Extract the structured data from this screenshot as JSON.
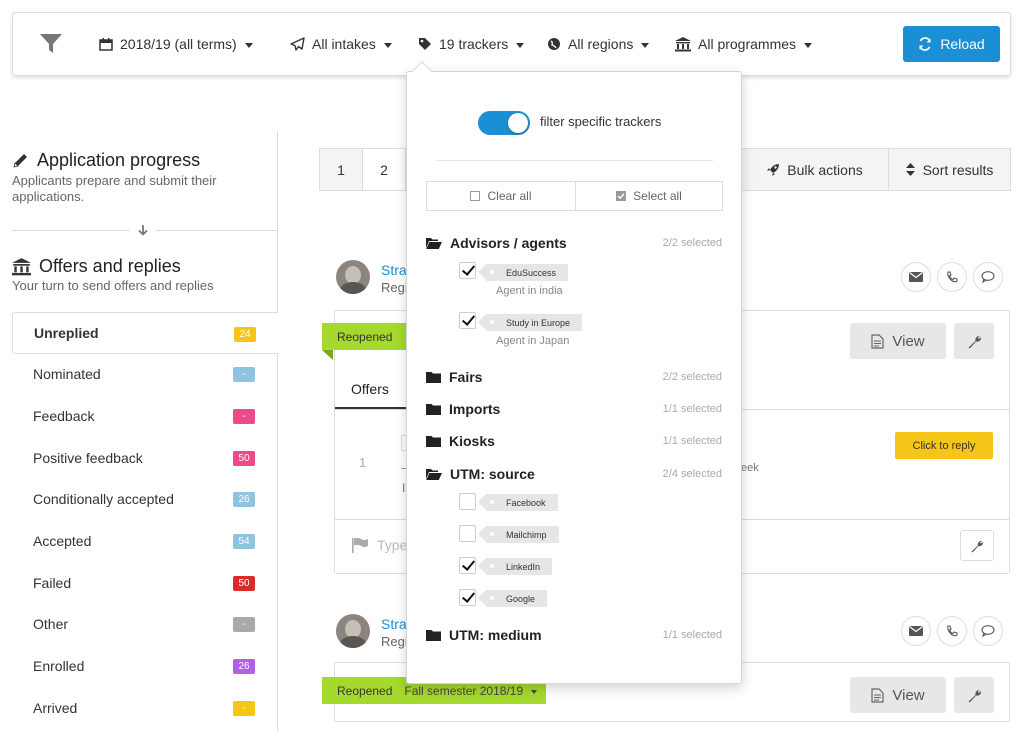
{
  "filterbar": {
    "year": "2018/19 (all terms)",
    "intakes": "All intakes",
    "trackers": "19 trackers",
    "regions": "All regions",
    "programmes": "All programmes",
    "reload": "Reload"
  },
  "left": {
    "progress_title": "Application progress",
    "progress_sub": "Applicants prepare and submit their applications.",
    "offers_title": "Offers and replies",
    "offers_sub": "Your turn to send offers and replies",
    "statuses": [
      {
        "label": "Unreplied",
        "count": "24",
        "color": "#f5c518"
      },
      {
        "label": "Nominated",
        "count": "-",
        "color": "#8fc3df"
      },
      {
        "label": "Feedback",
        "count": "-",
        "color": "#ee4a8a"
      },
      {
        "label": "Positive feedback",
        "count": "50",
        "color": "#ee4a8a"
      },
      {
        "label": "Conditionally accepted",
        "count": "26",
        "color": "#8fc3df"
      },
      {
        "label": "Accepted",
        "count": "54",
        "color": "#8fc3df"
      },
      {
        "label": "Failed",
        "count": "50",
        "color": "#d92b2b"
      },
      {
        "label": "Other",
        "count": "-",
        "color": "#aaaaaa"
      },
      {
        "label": "Enrolled",
        "count": "26",
        "color": "#b45ee8"
      },
      {
        "label": "Arrived",
        "count": "-",
        "color": "#f5c518"
      }
    ]
  },
  "main": {
    "page1": "1",
    "page2": "2",
    "bulk_actions": "Bulk actions",
    "sort_results": "Sort results",
    "card1": {
      "name": "Stra",
      "sub": "Regi",
      "tag": "Reopened",
      "view": "View",
      "tab": "Offers",
      "row_num": "1",
      "row_i": "I",
      "week": "eek",
      "click_reply": "Click to reply",
      "type_placeholder": "Type"
    },
    "card2": {
      "name": "Stra",
      "sub": "Regi",
      "tag": "Reopened",
      "semester": "Fall semester 2018/19",
      "view": "View"
    }
  },
  "dropdown": {
    "toggle_label": "filter specific trackers",
    "clear_all": "Clear all",
    "select_all": "Select all",
    "groups": {
      "advisors": {
        "name": "Advisors / agents",
        "count": "2/2 selected"
      },
      "fairs": {
        "name": "Fairs",
        "count": "2/2 selected"
      },
      "imports": {
        "name": "Imports",
        "count": "1/1 selected"
      },
      "kiosks": {
        "name": "Kiosks",
        "count": "1/1 selected"
      },
      "utm_source": {
        "name": "UTM: source",
        "count": "2/4 selected"
      },
      "utm_medium": {
        "name": "UTM: medium",
        "count": "1/1 selected"
      }
    },
    "trackers": {
      "edusuccess": {
        "label": "EduSuccess",
        "sub": "Agent in india",
        "checked": true
      },
      "study_europe": {
        "label": "Study in Europe",
        "sub": "Agent in Japan",
        "checked": true
      },
      "facebook": {
        "label": "Facebook",
        "checked": false
      },
      "mailchimp": {
        "label": "Mailchimp",
        "checked": false
      },
      "linkedin": {
        "label": "LinkedIn",
        "checked": true
      },
      "google": {
        "label": "Google",
        "checked": true
      }
    }
  },
  "colors": {
    "accent": "#1a8fd6",
    "tag_green": "#a6d92e",
    "reply_yellow": "#f5c518"
  }
}
